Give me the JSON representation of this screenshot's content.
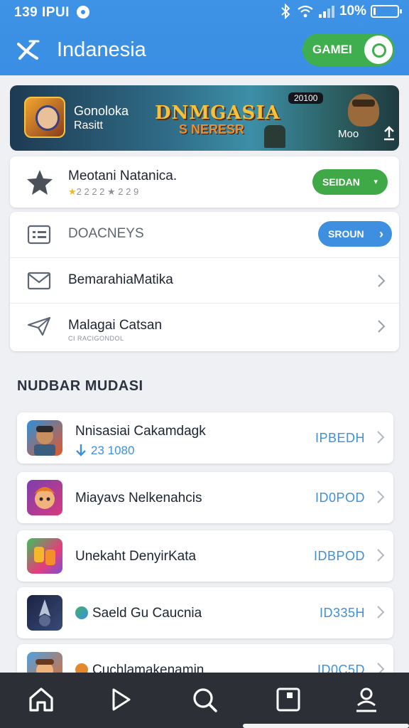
{
  "status_bar": {
    "time": "139 IPUI",
    "battery_text": "10%",
    "battery_level": 0.1
  },
  "header": {
    "title": "Indanesia",
    "toggle_label": "GAMEI"
  },
  "banner": {
    "title": "Gonoloka",
    "subtitle": "Rasitt",
    "headline": "DNMGASIA",
    "tagline": "S NERESR",
    "tag": "20100",
    "badge": "Moo"
  },
  "rating_card": {
    "title": "Meotani Natanica.",
    "stars": "★",
    "stars_text": "2 2 2 2 ★ 2 2 9",
    "button": "SEIDAN",
    "button_chevron": "▾"
  },
  "menu": {
    "header_label": "DOACNEYS",
    "header_button": "SROUN",
    "header_button_chevron": "›",
    "items": [
      {
        "label": "BemarahiaMatika"
      },
      {
        "label": "Malagai Catsan",
        "sublabel": "CI RACIGONDOL"
      }
    ]
  },
  "section": {
    "heading": "NUDBAR MUDASI"
  },
  "games": [
    {
      "name": "Nnisasiai Cakamdagk",
      "meta": "23 1080",
      "badge": "IPBEDH"
    },
    {
      "name": "Miayavs Nelkenahcis",
      "badge": "ID0POD"
    },
    {
      "name": "Unekaht DenyirKata",
      "badge": "IDBPOD"
    },
    {
      "name": "Saeld Gu Caucnia",
      "badge": "ID335H"
    },
    {
      "name": "Cuchlamakenamin",
      "badge": "ID0C5D"
    }
  ],
  "colors": {
    "header": "#3a8ee3",
    "accent_blue": "#3e8fe0",
    "accent_green": "#3fa847",
    "nav_bg": "#2c2f35"
  },
  "nav": {
    "items": [
      {
        "icon": "home-icon"
      },
      {
        "icon": "play-icon"
      },
      {
        "icon": "search-icon"
      },
      {
        "icon": "library-icon"
      },
      {
        "icon": "profile-icon"
      }
    ]
  }
}
